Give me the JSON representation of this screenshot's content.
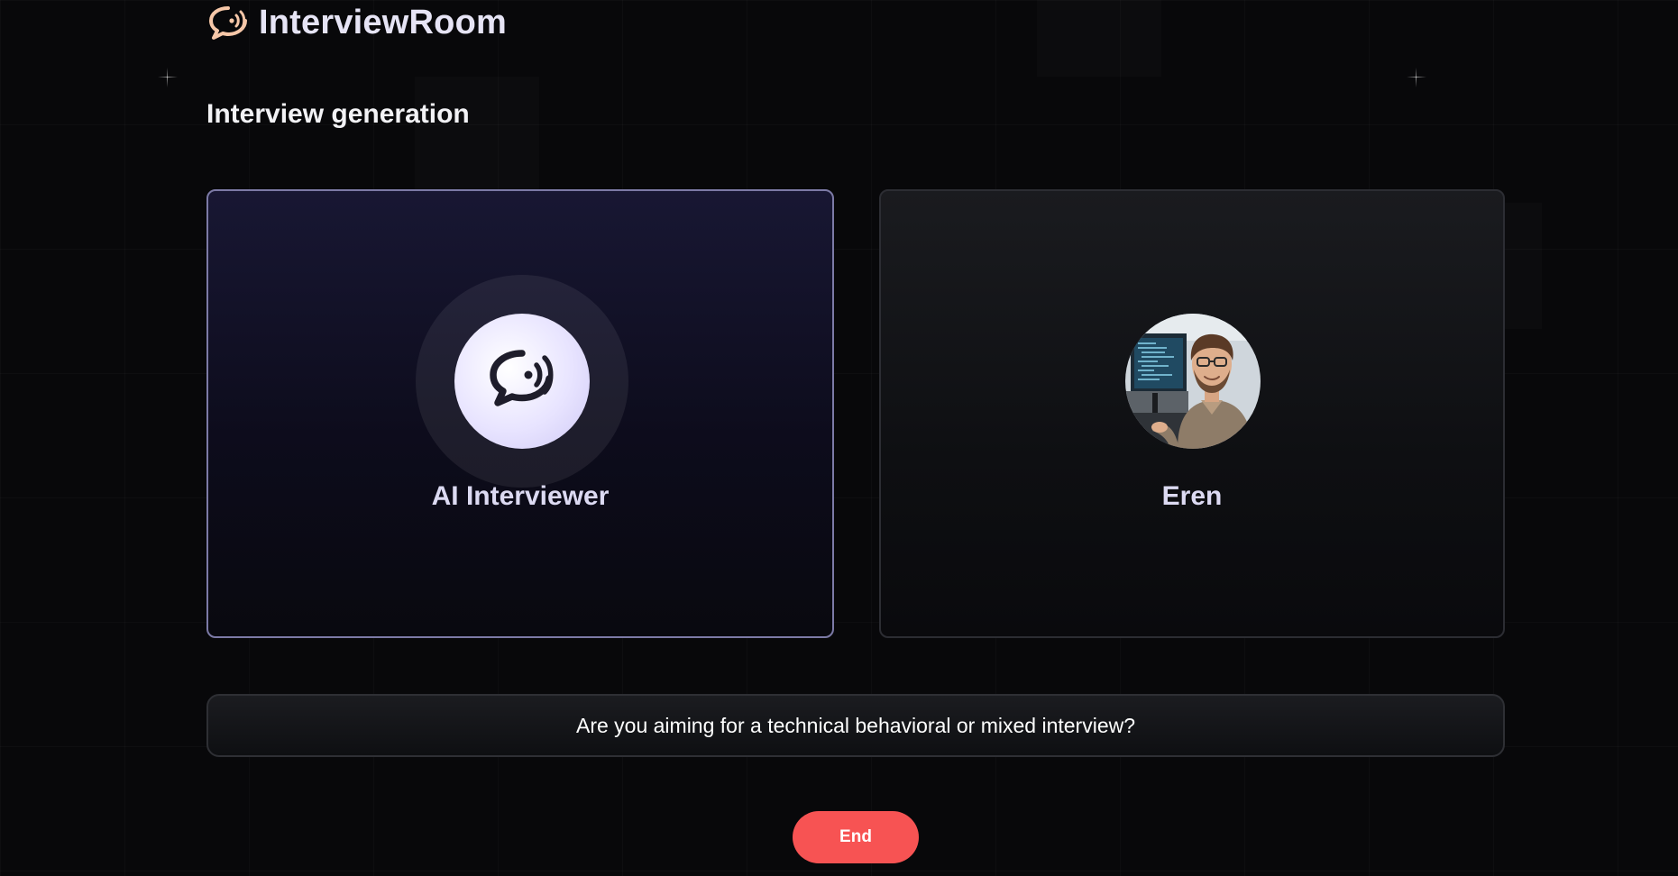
{
  "app": {
    "name": "InterviewRoom",
    "logo_icon": "chat-bubble-signal-icon"
  },
  "page": {
    "title": "Interview generation"
  },
  "interviewer_card": {
    "name": "AI Interviewer",
    "icon": "chat-bubble-signal-icon",
    "active": true
  },
  "user_card": {
    "name": "Eren",
    "avatar": "user-photo"
  },
  "transcript": {
    "message": "Are you aiming for a technical behavioral or mixed interview?"
  },
  "controls": {
    "end_label": "End"
  },
  "colors": {
    "accent_logo": "#f6c7a8",
    "end_button": "#f75353",
    "active_card_border": "#7c7aa6",
    "avatar_background": "#e8e4ff"
  }
}
